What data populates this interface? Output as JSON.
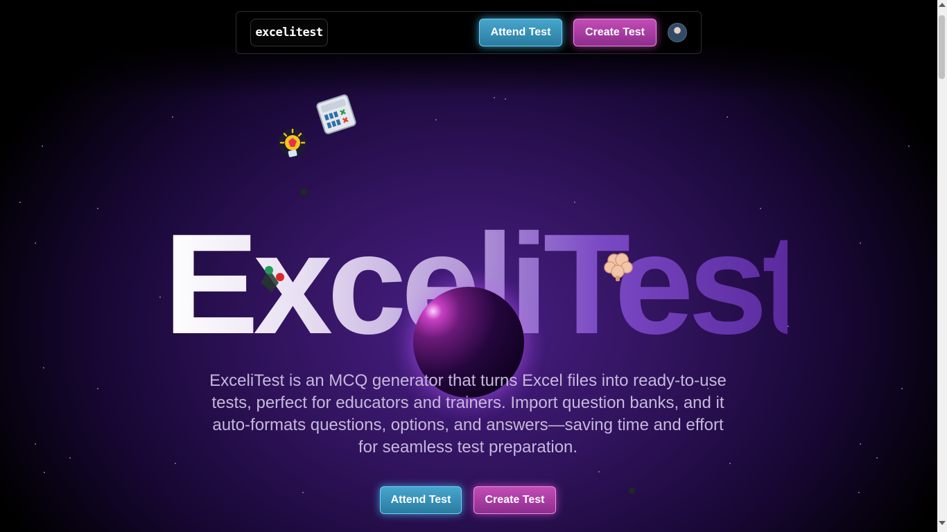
{
  "nav": {
    "logo_text": "excelitest",
    "attend_label": "Attend Test",
    "create_label": "Create Test"
  },
  "hero": {
    "title": "ExceliTest",
    "description": "ExceliTest is an MCQ generator that turns Excel files into ready-to-use tests, perfect for educators and trainers. Import question banks, and it auto-formats questions, options, and answers—saving time and effort for seamless test preparation.",
    "attend_label": "Attend Test",
    "create_label": "Create Test"
  },
  "decor_icons": [
    "lightbulb-icon",
    "calculator-icon",
    "flask-icon",
    "brain-icon"
  ],
  "colors": {
    "attend_button": "#2f86ad",
    "create_button": "#a43aa0",
    "background": "#000000",
    "hero_glow": "#4a1f86"
  }
}
